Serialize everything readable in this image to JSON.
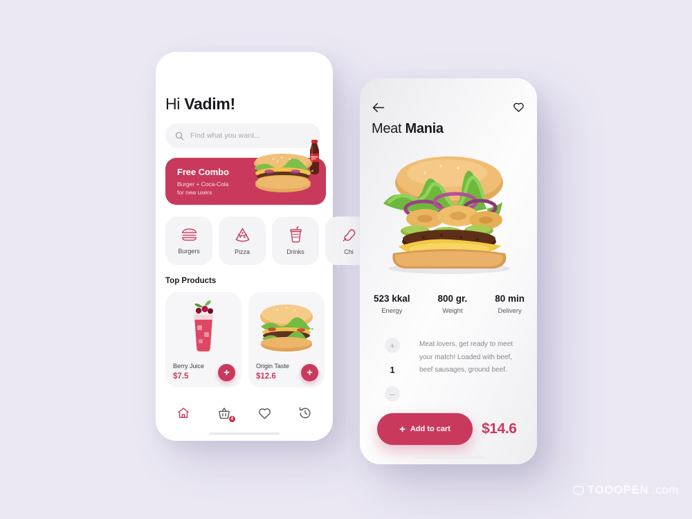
{
  "accent": "#c9395c",
  "background": "#ebe8f4",
  "watermark": {
    "text": "TOOOPEN",
    "suffix": ".com"
  },
  "home_screen": {
    "greeting_prefix": "Hi ",
    "greeting_name": "Vadim!",
    "search": {
      "placeholder": "Find what you want...",
      "icon": "search-icon"
    },
    "promo_banner": {
      "title": "Free Combo",
      "line1": "Burger + Coca-Cola",
      "line2": "for new users"
    },
    "categories": [
      {
        "label": "Burgers",
        "icon": "burger-icon"
      },
      {
        "label": "Pizza",
        "icon": "pizza-slice-icon"
      },
      {
        "label": "Drinks",
        "icon": "soda-cup-icon"
      },
      {
        "label": "Chi",
        "icon": "chicken-icon"
      }
    ],
    "section_title": "Top Products",
    "products": [
      {
        "name": "Berry Juice",
        "price": "$7.5",
        "add_label": "+"
      },
      {
        "name": "Origin Taste",
        "price": "$12.6",
        "add_label": "+"
      }
    ],
    "tabbar": [
      {
        "name": "home",
        "icon": "home-icon",
        "active": true,
        "badge": null
      },
      {
        "name": "cart",
        "icon": "basket-icon",
        "active": false,
        "badge": "4"
      },
      {
        "name": "favorites",
        "icon": "heart-icon",
        "active": false,
        "badge": null
      },
      {
        "name": "history",
        "icon": "history-icon",
        "active": false,
        "badge": null
      }
    ]
  },
  "detail_screen": {
    "back_icon": "arrow-left-icon",
    "favorite_icon": "heart-icon",
    "title_prefix": "Meat ",
    "title_bold": "Mania",
    "stats": [
      {
        "value": "523 kkal",
        "label": "Energy"
      },
      {
        "value": "800 gr.",
        "label": "Weight"
      },
      {
        "value": "80 min",
        "label": "Delivery"
      }
    ],
    "quantity": {
      "increment": "+",
      "value": "1",
      "decrement": "–"
    },
    "description": "Meat lovers, get ready to meet your match! Loaded with beef, beef sausages, ground beef.",
    "cta": {
      "plus": "+",
      "label": "Add to cart"
    },
    "price": "$14.6"
  }
}
